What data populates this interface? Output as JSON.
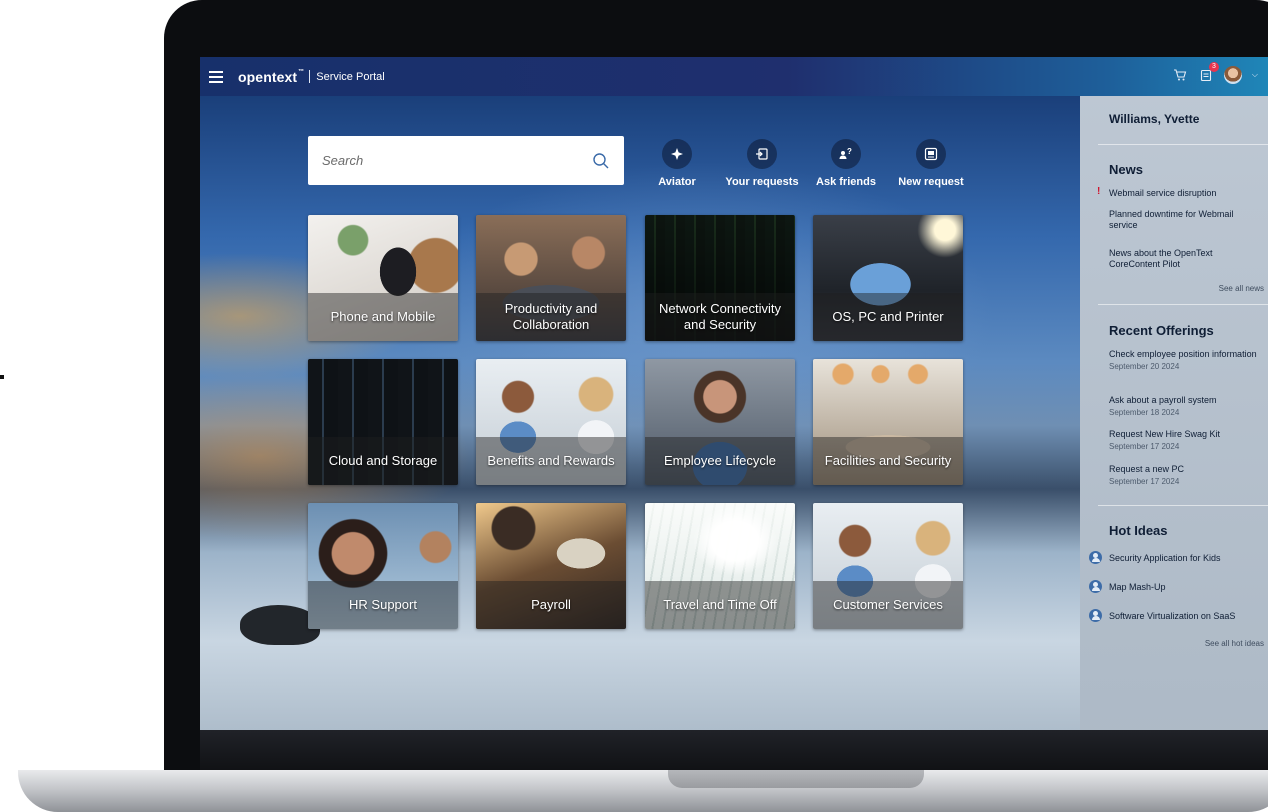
{
  "header": {
    "brand": "opentext",
    "brand_tm": "™",
    "portal_name": "Service Portal",
    "requests_badge_count": "3"
  },
  "search": {
    "placeholder": "Search"
  },
  "quick_actions": [
    {
      "label": "Aviator",
      "icon": "aviator-icon"
    },
    {
      "label": "Your requests",
      "icon": "requests-icon"
    },
    {
      "label": "Ask friends",
      "icon": "ask-friends-icon"
    },
    {
      "label": "New request",
      "icon": "new-request-icon"
    }
  ],
  "tiles": [
    {
      "label": "Phone and Mobile"
    },
    {
      "label": "Productivity and Collaboration"
    },
    {
      "label": "Network Connectivity and Security"
    },
    {
      "label": "OS, PC and Printer"
    },
    {
      "label": "Cloud and Storage"
    },
    {
      "label": "Benefits and Rewards"
    },
    {
      "label": "Employee Lifecycle"
    },
    {
      "label": "Facilities and Security"
    },
    {
      "label": "HR Support"
    },
    {
      "label": "Payroll"
    },
    {
      "label": "Travel and Time Off"
    },
    {
      "label": "Customer Services"
    }
  ],
  "sidebar": {
    "user_name": "Williams, Yvette",
    "news": {
      "title": "News",
      "alert_mark": "!",
      "items": [
        {
          "label": "Webmail service disruption"
        },
        {
          "label": "Planned downtime for Webmail service"
        },
        {
          "label": "News about the OpenText CoreContent Pilot"
        }
      ],
      "see_all": "See all news"
    },
    "recent_offerings": {
      "title": "Recent Offerings",
      "items": [
        {
          "label": "Check employee position information",
          "date": "September 20 2024"
        },
        {
          "label": "Ask about a payroll system",
          "date": "September 18 2024"
        },
        {
          "label": "Request New Hire Swag Kit",
          "date": "September 17 2024"
        },
        {
          "label": "Request a new PC",
          "date": "September 17 2024"
        }
      ]
    },
    "hot_ideas": {
      "title": "Hot Ideas",
      "items": [
        {
          "label": "Security Application for Kids"
        },
        {
          "label": "Map Mash-Up"
        },
        {
          "label": "Software Virtualization on SaaS"
        }
      ],
      "see_all": "See all hot ideas"
    }
  },
  "colors": {
    "topbar_start": "#17306b",
    "topbar_end": "#1f86b8",
    "alert_red": "#d0152e",
    "badge_red": "#e8344e"
  }
}
